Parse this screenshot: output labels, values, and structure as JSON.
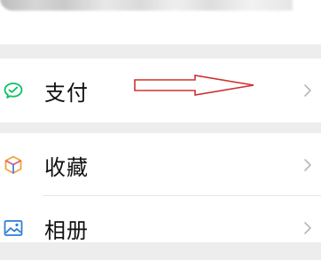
{
  "menu": {
    "items": [
      {
        "label": "支付",
        "icon": "wechat-pay-icon",
        "icon_color": "#07c160"
      },
      {
        "label": "收藏",
        "icon": "favorites-cube-icon",
        "icon_color": "#f0a43a"
      },
      {
        "label": "相册",
        "icon": "album-picture-icon",
        "icon_color": "#2f7fd6"
      }
    ]
  },
  "annotation": {
    "arrow_color": "#d03030"
  },
  "colors": {
    "background": "#ededed",
    "row_bg": "#ffffff",
    "chevron": "#b8b8b8"
  }
}
